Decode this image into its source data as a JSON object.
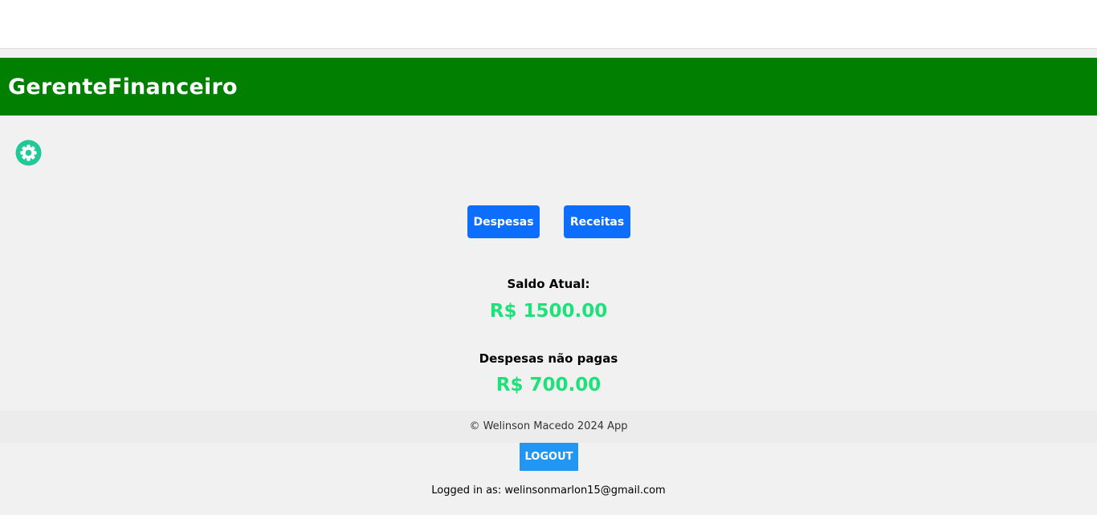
{
  "header": {
    "brand": "GerenteFinanceiro"
  },
  "toolbar": {
    "settings_icon": "gear-icon"
  },
  "nav": {
    "despesas_label": "Despesas",
    "receitas_label": "Receitas"
  },
  "summary": {
    "saldo_label": "Saldo Atual:",
    "saldo_value": "R$ 1500.00",
    "despesas_label": "Despesas não pagas",
    "despesas_value": "R$ 700.00"
  },
  "footer": {
    "copyright": "© Welinson Macedo 2024 App",
    "logout_label": "LOGOUT",
    "logged_in_text": "Logged in as: welinsonmarlon15@gmail.com"
  },
  "colors": {
    "header_bg": "#007f00",
    "primary_button": "#0d6efd",
    "amount_text": "#1de27a",
    "gear": "#20c997",
    "logout_button": "#2196f3"
  }
}
